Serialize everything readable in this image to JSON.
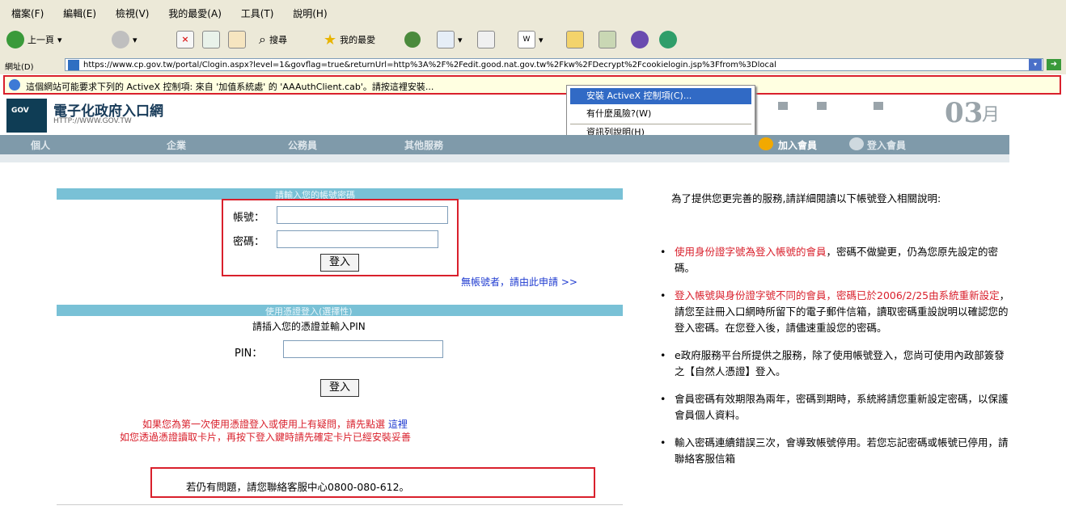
{
  "menu": [
    "檔案(F)",
    "編輯(E)",
    "檢視(V)",
    "我的最愛(A)",
    "工具(T)",
    "說明(H)"
  ],
  "toolbar": {
    "back": "上一頁",
    "search": "搜尋",
    "favorites": "我的最愛"
  },
  "address": {
    "label": "網址(D)",
    "url": "https://www.cp.gov.tw/portal/Clogin.aspx?level=1&govflag=true&returnUrl=http%3A%2F%2Fedit.good.nat.gov.tw%2Fkw%2FDecrypt%2Fcookielogin.jsp%3Ffrom%3Dlocal"
  },
  "infobar": {
    "text": "這個網站可能要求下列的 ActiveX 控制項: 來自 '加值系統處' 的 'AAAuthClient.cab'。請按這裡安裝..."
  },
  "context_menu": {
    "items": [
      "安裝 ActiveX 控制項(C)...",
      "有什麼風險?(W)",
      "資訊列說明(H)"
    ]
  },
  "header": {
    "title": "電子化政府入口網",
    "url": "HTTP://WWW.GOV.TW",
    "day": "03",
    "month": "月"
  },
  "nav": {
    "items": [
      "個人",
      "企業",
      "公務員",
      "其他服務"
    ],
    "join": "加入會員",
    "login_member": "登入會員"
  },
  "login": {
    "strip": "請輸入您的帳號密碼",
    "account_label": "帳號：",
    "password_label": "密碼：",
    "submit": "登入",
    "register_link": "無帳號者，請由此申請 >>"
  },
  "cert": {
    "strip": "使用憑證登入(選擇性)",
    "instruction": "請插入您的憑證並輸入PIN",
    "pin_label": "PIN：",
    "submit": "登入",
    "help_line1": "如果您為第一次使用憑證登入或使用上有疑問，請先點選",
    "help_link": "這裡",
    "help_line2": "如您透過憑證讀取卡片，再按下登入鍵時請先確定卡片已經安裝妥善"
  },
  "contact": {
    "text": "若仍有問題，請您聯絡客服中心0800-080-612。"
  },
  "notes": {
    "intro": "為了提供您更完善的服務,請詳細閱讀以下帳號登入相關說明:",
    "items": [
      {
        "red": "使用身份證字號為登入帳號的會員",
        "rest": "，密碼不做變更，仍為您原先設定的密碼。"
      },
      {
        "red": "登入帳號與身份證字號不同的會員，密碼已於2006/2/25由系統重新設定",
        "rest": "，請您至註冊入口網時所留下的電子郵件信箱，讀取密碼重設說明以確認您的登入密碼。在您登入後，請儘速重設您的密碼。"
      },
      {
        "red": "",
        "rest": "e政府服務平台所提供之服務，除了使用帳號登入，您尚可使用內政部簽發之【自然人憑證】登入。"
      },
      {
        "red": "",
        "rest": "會員密碼有效期限為兩年，密碼到期時，系統將請您重新設定密碼，以保護會員個人資料。"
      },
      {
        "red": "",
        "rest": "輸入密碼連續錯誤三次，會導致帳號停用。若您忘記密碼或帳號已停用，請聯絡客服信箱"
      }
    ]
  }
}
